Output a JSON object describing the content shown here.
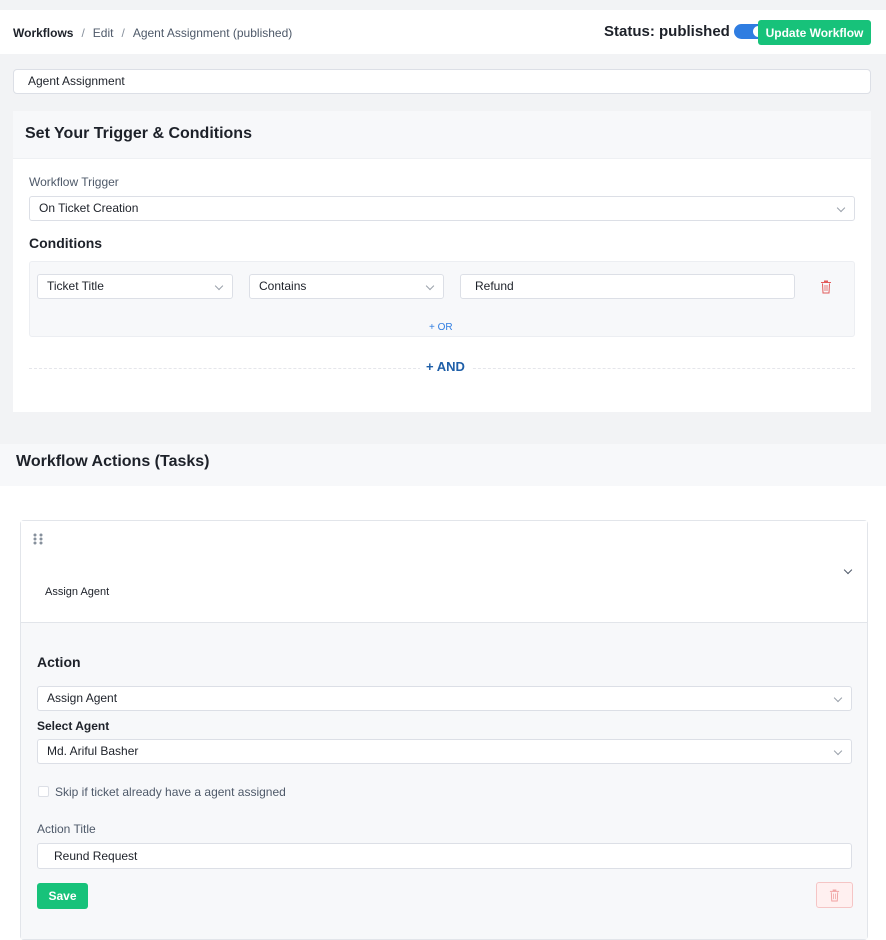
{
  "breadcrumb": {
    "root": "Workflows",
    "sep1": "/",
    "edit": "Edit",
    "sep2": "/",
    "current": "Agent Assignment (published)"
  },
  "status": {
    "label": "Status: published",
    "enabled": true
  },
  "update_button": "Update Workflow",
  "workflow_name": "Agent Assignment",
  "trigger_card": {
    "heading": "Set Your Trigger & Conditions",
    "trigger_label": "Workflow Trigger",
    "trigger_value": "On Ticket Creation",
    "conditions_label": "Conditions",
    "condition": {
      "field": "Ticket Title",
      "operator": "Contains",
      "value": "Refund"
    },
    "or_label": "+ OR",
    "and_label": "+ AND"
  },
  "actions": {
    "heading": "Workflow Actions (Tasks)",
    "task": {
      "title": "Assign Agent",
      "action_label": "Action",
      "action_value": "Assign Agent",
      "select_agent_label": "Select Agent",
      "agent_value": "Md. Ariful Basher",
      "skip_checkbox_label": "Skip if ticket already have a agent assigned",
      "skip_checked": false,
      "action_title_label": "Action Title",
      "action_title_value": "Reund Request",
      "save_label": "Save"
    }
  },
  "colors": {
    "accent_green": "#17c27a",
    "toggle_blue": "#2f7de1",
    "link_blue": "#2f7de1",
    "danger_red": "#e25b5b"
  }
}
